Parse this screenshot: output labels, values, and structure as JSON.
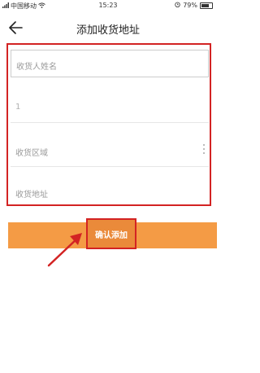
{
  "status_bar": {
    "carrier": "中国移动",
    "time": "15:23",
    "battery": "79%"
  },
  "header": {
    "title": "添加收货地址"
  },
  "form": {
    "name_placeholder": "收货人姓名",
    "phone_value": "1",
    "region_placeholder": "收货区域",
    "address_placeholder": "收货地址"
  },
  "actions": {
    "confirm_label": "确认添加"
  },
  "colors": {
    "accent_orange": "#f49b45",
    "highlight_red": "#d32323"
  }
}
